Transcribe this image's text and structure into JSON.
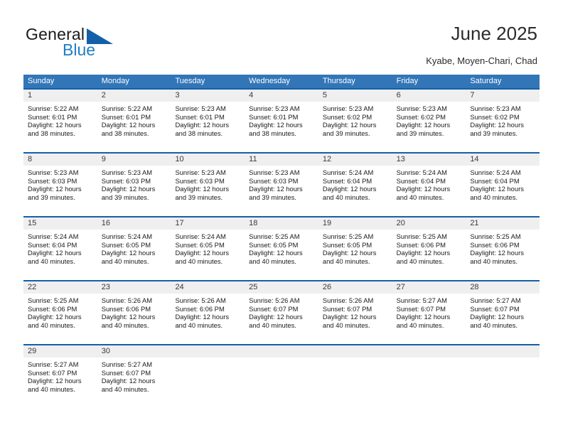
{
  "brand": {
    "name_part1": "General",
    "name_part2": "Blue",
    "triangle_color": "#1360a8",
    "blue_color": "#1f7ec4"
  },
  "header": {
    "title": "June 2025",
    "subtitle": "Kyabe, Moyen-Chari, Chad"
  },
  "theme": {
    "header_row_bg": "#3276b8",
    "cell_top_border": "#1360a8",
    "daynum_band_bg": "#efefef"
  },
  "weekdays": [
    "Sunday",
    "Monday",
    "Tuesday",
    "Wednesday",
    "Thursday",
    "Friday",
    "Saturday"
  ],
  "weeks": [
    [
      {
        "day": "1",
        "sunrise": "Sunrise: 5:22 AM",
        "sunset": "Sunset: 6:01 PM",
        "daylight1": "Daylight: 12 hours",
        "daylight2": "and 38 minutes."
      },
      {
        "day": "2",
        "sunrise": "Sunrise: 5:22 AM",
        "sunset": "Sunset: 6:01 PM",
        "daylight1": "Daylight: 12 hours",
        "daylight2": "and 38 minutes."
      },
      {
        "day": "3",
        "sunrise": "Sunrise: 5:23 AM",
        "sunset": "Sunset: 6:01 PM",
        "daylight1": "Daylight: 12 hours",
        "daylight2": "and 38 minutes."
      },
      {
        "day": "4",
        "sunrise": "Sunrise: 5:23 AM",
        "sunset": "Sunset: 6:01 PM",
        "daylight1": "Daylight: 12 hours",
        "daylight2": "and 38 minutes."
      },
      {
        "day": "5",
        "sunrise": "Sunrise: 5:23 AM",
        "sunset": "Sunset: 6:02 PM",
        "daylight1": "Daylight: 12 hours",
        "daylight2": "and 39 minutes."
      },
      {
        "day": "6",
        "sunrise": "Sunrise: 5:23 AM",
        "sunset": "Sunset: 6:02 PM",
        "daylight1": "Daylight: 12 hours",
        "daylight2": "and 39 minutes."
      },
      {
        "day": "7",
        "sunrise": "Sunrise: 5:23 AM",
        "sunset": "Sunset: 6:02 PM",
        "daylight1": "Daylight: 12 hours",
        "daylight2": "and 39 minutes."
      }
    ],
    [
      {
        "day": "8",
        "sunrise": "Sunrise: 5:23 AM",
        "sunset": "Sunset: 6:03 PM",
        "daylight1": "Daylight: 12 hours",
        "daylight2": "and 39 minutes."
      },
      {
        "day": "9",
        "sunrise": "Sunrise: 5:23 AM",
        "sunset": "Sunset: 6:03 PM",
        "daylight1": "Daylight: 12 hours",
        "daylight2": "and 39 minutes."
      },
      {
        "day": "10",
        "sunrise": "Sunrise: 5:23 AM",
        "sunset": "Sunset: 6:03 PM",
        "daylight1": "Daylight: 12 hours",
        "daylight2": "and 39 minutes."
      },
      {
        "day": "11",
        "sunrise": "Sunrise: 5:23 AM",
        "sunset": "Sunset: 6:03 PM",
        "daylight1": "Daylight: 12 hours",
        "daylight2": "and 39 minutes."
      },
      {
        "day": "12",
        "sunrise": "Sunrise: 5:24 AM",
        "sunset": "Sunset: 6:04 PM",
        "daylight1": "Daylight: 12 hours",
        "daylight2": "and 40 minutes."
      },
      {
        "day": "13",
        "sunrise": "Sunrise: 5:24 AM",
        "sunset": "Sunset: 6:04 PM",
        "daylight1": "Daylight: 12 hours",
        "daylight2": "and 40 minutes."
      },
      {
        "day": "14",
        "sunrise": "Sunrise: 5:24 AM",
        "sunset": "Sunset: 6:04 PM",
        "daylight1": "Daylight: 12 hours",
        "daylight2": "and 40 minutes."
      }
    ],
    [
      {
        "day": "15",
        "sunrise": "Sunrise: 5:24 AM",
        "sunset": "Sunset: 6:04 PM",
        "daylight1": "Daylight: 12 hours",
        "daylight2": "and 40 minutes."
      },
      {
        "day": "16",
        "sunrise": "Sunrise: 5:24 AM",
        "sunset": "Sunset: 6:05 PM",
        "daylight1": "Daylight: 12 hours",
        "daylight2": "and 40 minutes."
      },
      {
        "day": "17",
        "sunrise": "Sunrise: 5:24 AM",
        "sunset": "Sunset: 6:05 PM",
        "daylight1": "Daylight: 12 hours",
        "daylight2": "and 40 minutes."
      },
      {
        "day": "18",
        "sunrise": "Sunrise: 5:25 AM",
        "sunset": "Sunset: 6:05 PM",
        "daylight1": "Daylight: 12 hours",
        "daylight2": "and 40 minutes."
      },
      {
        "day": "19",
        "sunrise": "Sunrise: 5:25 AM",
        "sunset": "Sunset: 6:05 PM",
        "daylight1": "Daylight: 12 hours",
        "daylight2": "and 40 minutes."
      },
      {
        "day": "20",
        "sunrise": "Sunrise: 5:25 AM",
        "sunset": "Sunset: 6:06 PM",
        "daylight1": "Daylight: 12 hours",
        "daylight2": "and 40 minutes."
      },
      {
        "day": "21",
        "sunrise": "Sunrise: 5:25 AM",
        "sunset": "Sunset: 6:06 PM",
        "daylight1": "Daylight: 12 hours",
        "daylight2": "and 40 minutes."
      }
    ],
    [
      {
        "day": "22",
        "sunrise": "Sunrise: 5:25 AM",
        "sunset": "Sunset: 6:06 PM",
        "daylight1": "Daylight: 12 hours",
        "daylight2": "and 40 minutes."
      },
      {
        "day": "23",
        "sunrise": "Sunrise: 5:26 AM",
        "sunset": "Sunset: 6:06 PM",
        "daylight1": "Daylight: 12 hours",
        "daylight2": "and 40 minutes."
      },
      {
        "day": "24",
        "sunrise": "Sunrise: 5:26 AM",
        "sunset": "Sunset: 6:06 PM",
        "daylight1": "Daylight: 12 hours",
        "daylight2": "and 40 minutes."
      },
      {
        "day": "25",
        "sunrise": "Sunrise: 5:26 AM",
        "sunset": "Sunset: 6:07 PM",
        "daylight1": "Daylight: 12 hours",
        "daylight2": "and 40 minutes."
      },
      {
        "day": "26",
        "sunrise": "Sunrise: 5:26 AM",
        "sunset": "Sunset: 6:07 PM",
        "daylight1": "Daylight: 12 hours",
        "daylight2": "and 40 minutes."
      },
      {
        "day": "27",
        "sunrise": "Sunrise: 5:27 AM",
        "sunset": "Sunset: 6:07 PM",
        "daylight1": "Daylight: 12 hours",
        "daylight2": "and 40 minutes."
      },
      {
        "day": "28",
        "sunrise": "Sunrise: 5:27 AM",
        "sunset": "Sunset: 6:07 PM",
        "daylight1": "Daylight: 12 hours",
        "daylight2": "and 40 minutes."
      }
    ],
    [
      {
        "day": "29",
        "sunrise": "Sunrise: 5:27 AM",
        "sunset": "Sunset: 6:07 PM",
        "daylight1": "Daylight: 12 hours",
        "daylight2": "and 40 minutes."
      },
      {
        "day": "30",
        "sunrise": "Sunrise: 5:27 AM",
        "sunset": "Sunset: 6:07 PM",
        "daylight1": "Daylight: 12 hours",
        "daylight2": "and 40 minutes."
      },
      {
        "day": "",
        "sunrise": "",
        "sunset": "",
        "daylight1": "",
        "daylight2": ""
      },
      {
        "day": "",
        "sunrise": "",
        "sunset": "",
        "daylight1": "",
        "daylight2": ""
      },
      {
        "day": "",
        "sunrise": "",
        "sunset": "",
        "daylight1": "",
        "daylight2": ""
      },
      {
        "day": "",
        "sunrise": "",
        "sunset": "",
        "daylight1": "",
        "daylight2": ""
      },
      {
        "day": "",
        "sunrise": "",
        "sunset": "",
        "daylight1": "",
        "daylight2": ""
      }
    ]
  ]
}
